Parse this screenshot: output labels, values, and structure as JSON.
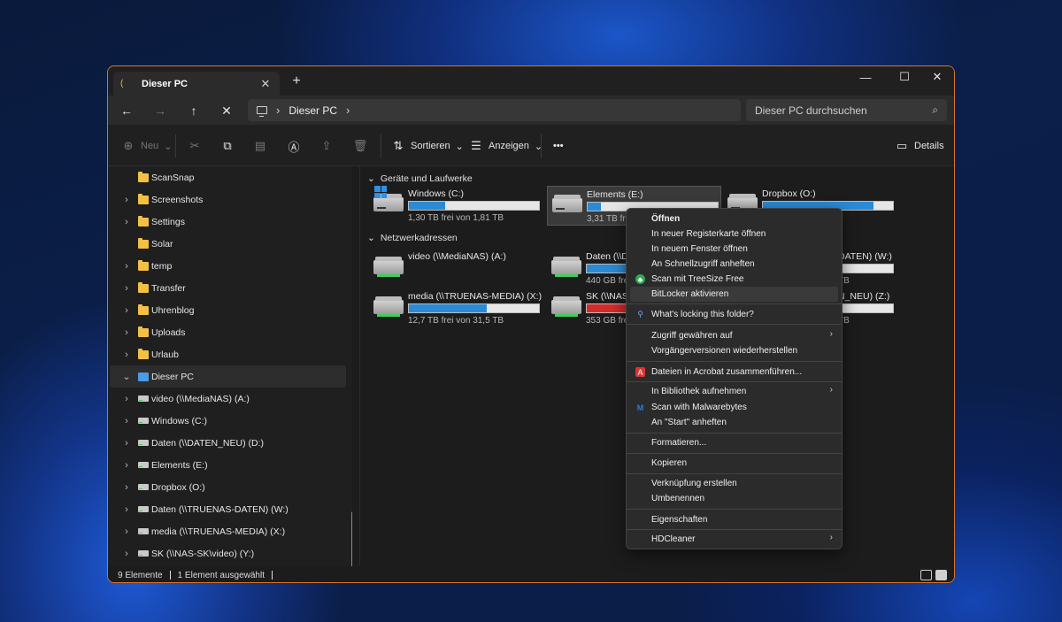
{
  "tab": {
    "title": "Dieser PC",
    "close": "✕",
    "new": "+"
  },
  "window_controls": {
    "minimize": "—",
    "maximize": "☐",
    "close": "✕"
  },
  "nav": {
    "back": "←",
    "forward": "→",
    "up": "↑",
    "refresh": "✕"
  },
  "address": {
    "crumb": "Dieser PC",
    "sep": "›"
  },
  "search": {
    "placeholder": "Dieser PC durchsuchen",
    "icon": "⌕"
  },
  "toolbar": {
    "new_label": "Neu",
    "sort_label": "Sortieren",
    "view_label": "Anzeigen",
    "more_label": "•••",
    "details_label": "Details"
  },
  "sidebar": {
    "items": [
      {
        "label": "ScanSnap",
        "chevron": "",
        "icon": "folder"
      },
      {
        "label": "Screenshots",
        "chevron": "›",
        "icon": "folder"
      },
      {
        "label": "Settings",
        "chevron": "›",
        "icon": "folder"
      },
      {
        "label": "Solar",
        "chevron": "",
        "icon": "folder"
      },
      {
        "label": "temp",
        "chevron": "›",
        "icon": "folder"
      },
      {
        "label": "Transfer",
        "chevron": "›",
        "icon": "folder"
      },
      {
        "label": "Uhrenblog",
        "chevron": "›",
        "icon": "folder"
      },
      {
        "label": "Uploads",
        "chevron": "›",
        "icon": "folder"
      },
      {
        "label": "Urlaub",
        "chevron": "›",
        "icon": "folder"
      },
      {
        "label": "Dieser PC",
        "chevron": "⌄",
        "icon": "pc"
      },
      {
        "label": "video (\\\\MediaNAS) (A:)",
        "chevron": "›",
        "icon": "drive"
      },
      {
        "label": "Windows (C:)",
        "chevron": "›",
        "icon": "drive"
      },
      {
        "label": "Daten (\\\\DATEN_NEU) (D:)",
        "chevron": "›",
        "icon": "drive"
      },
      {
        "label": "Elements (E:)",
        "chevron": "›",
        "icon": "drive"
      },
      {
        "label": "Dropbox (O:)",
        "chevron": "›",
        "icon": "drive"
      },
      {
        "label": "Daten (\\\\TRUENAS-DATEN) (W:)",
        "chevron": "›",
        "icon": "drive"
      },
      {
        "label": "media (\\\\TRUENAS-MEDIA) (X:)",
        "chevron": "›",
        "icon": "drive"
      },
      {
        "label": "SK (\\\\NAS-SK\\video) (Y:)",
        "chevron": "›",
        "icon": "drive"
      }
    ]
  },
  "groups": {
    "devices": "Geräte und Laufwerke",
    "network": "Netzwerkadressen",
    "chevron": "⌄"
  },
  "drives": [
    {
      "name": "Windows (C:)",
      "info": "1,30 TB frei von 1,81 TB",
      "used": 0.28
    },
    {
      "name": "Elements (E:)",
      "info": "3,31 TB frei",
      "used": 0.1
    },
    {
      "name": "Dropbox (O:)",
      "info": "TB",
      "used": 0.85
    },
    {
      "name": "video (\\\\MediaNAS) (A:)",
      "info": "",
      "used": null
    },
    {
      "name": "Daten (\\\\D",
      "info": "440 GB fre",
      "used": 0.6
    },
    {
      "name": "DATEN) (W:)",
      "info": "TB",
      "used": 0
    },
    {
      "name": "media (\\\\TRUENAS-MEDIA) (X:)",
      "info": "12,7 TB frei von 31,5 TB",
      "used": 0.6
    },
    {
      "name": "SK (\\\\NAS-",
      "info": "353 GB fre",
      "used": 0.9,
      "color": "red"
    },
    {
      "name": "N_NEU) (Z:)",
      "info": "TB",
      "used": 0
    }
  ],
  "status": {
    "count": "9 Elemente",
    "selected": "1 Element ausgewählt"
  },
  "context_menu": {
    "items": [
      {
        "label": "Öffnen",
        "bold": true
      },
      {
        "label": "In neuer Registerkarte öffnen"
      },
      {
        "label": "In neuem Fenster öffnen"
      },
      {
        "label": "An Schnellzugriff anheften"
      },
      {
        "label": "Scan mit TreeSize Free",
        "icon": "treesize-icon"
      },
      {
        "label": "BitLocker aktivieren",
        "hover": true
      },
      {
        "label": "What's locking this folder?",
        "icon": "lock-search-icon"
      },
      {
        "label": "Zugriff gewähren auf",
        "submenu": true
      },
      {
        "label": "Vorgängerversionen wiederherstellen"
      },
      {
        "label": "Dateien in Acrobat zusammenführen...",
        "icon": "acrobat-icon"
      },
      {
        "label": "In Bibliothek aufnehmen",
        "submenu": true
      },
      {
        "label": "Scan with Malwarebytes",
        "icon": "malwarebytes-icon"
      },
      {
        "label": "An \"Start\" anheften"
      },
      {
        "label": "Formatieren..."
      },
      {
        "label": "Kopieren"
      },
      {
        "label": "Verknüpfung erstellen"
      },
      {
        "label": "Umbenennen"
      },
      {
        "label": "Eigenschaften"
      },
      {
        "label": "HDCleaner",
        "submenu": true
      }
    ],
    "submenu_arrow": "›"
  },
  "colors": {
    "accent_border": "#d8742e",
    "drive_bar": "#2a8ad6",
    "drive_bar_full": "#d42b2b"
  }
}
